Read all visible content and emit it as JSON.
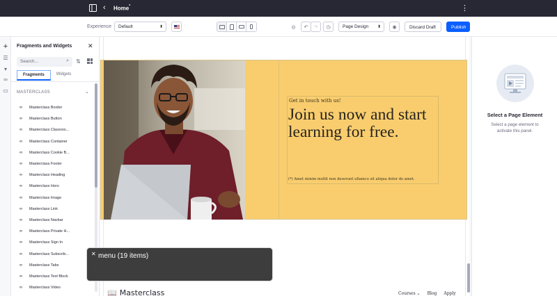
{
  "topbar": {
    "title": "Home",
    "draft_marker": "*"
  },
  "toolbar": {
    "experience_label": "Experience",
    "experience_value": "Default",
    "page_mode_value": "Page Design",
    "discard_label": "Discard Draft",
    "publish_label": "Publish"
  },
  "panel": {
    "title": "Fragments and Widgets",
    "search_placeholder": "Search...",
    "tabs": [
      {
        "label": "Fragments"
      },
      {
        "label": "Widgets"
      }
    ],
    "category": "MASTERCLASS",
    "items": [
      {
        "label": "Masterclass Border"
      },
      {
        "label": "Masterclass Button"
      },
      {
        "label": "Masterclass Classroo..."
      },
      {
        "label": "Masterclass Container"
      },
      {
        "label": "Masterclass Cookie B..."
      },
      {
        "label": "Masterclass Footer"
      },
      {
        "label": "Masterclass Heading"
      },
      {
        "label": "Masterclass Hero"
      },
      {
        "label": "Masterclass Image"
      },
      {
        "label": "Masterclass Link"
      },
      {
        "label": "Masterclass Navbar"
      },
      {
        "label": "Masterclass Private H..."
      },
      {
        "label": "Masterclass Sign In"
      },
      {
        "label": "Masterclass Subscrib..."
      },
      {
        "label": "Masterclass Tabs"
      },
      {
        "label": "Masterclass Text Block"
      },
      {
        "label": "Masterclass Video"
      }
    ]
  },
  "hero": {
    "eyebrow": "Get in touch with us!",
    "headline": "Join us now and start learning for free.",
    "fine_print": "(*) Amet minim mollit non deserunt ullamco sit aliqua dolor do amet."
  },
  "footer": {
    "brand": "Masterclass",
    "nav": [
      {
        "label": "Courses"
      },
      {
        "label": "Blog"
      },
      {
        "label": "Apply"
      }
    ]
  },
  "right_panel": {
    "title": "Select a Page Element",
    "description": "Select a page element to activate this panel."
  },
  "screen_reader": {
    "text": "menu (19 items)"
  },
  "colors": {
    "topbar": "#272833",
    "primary": "#0b5fff",
    "hero_bg": "#f9cd6e"
  }
}
